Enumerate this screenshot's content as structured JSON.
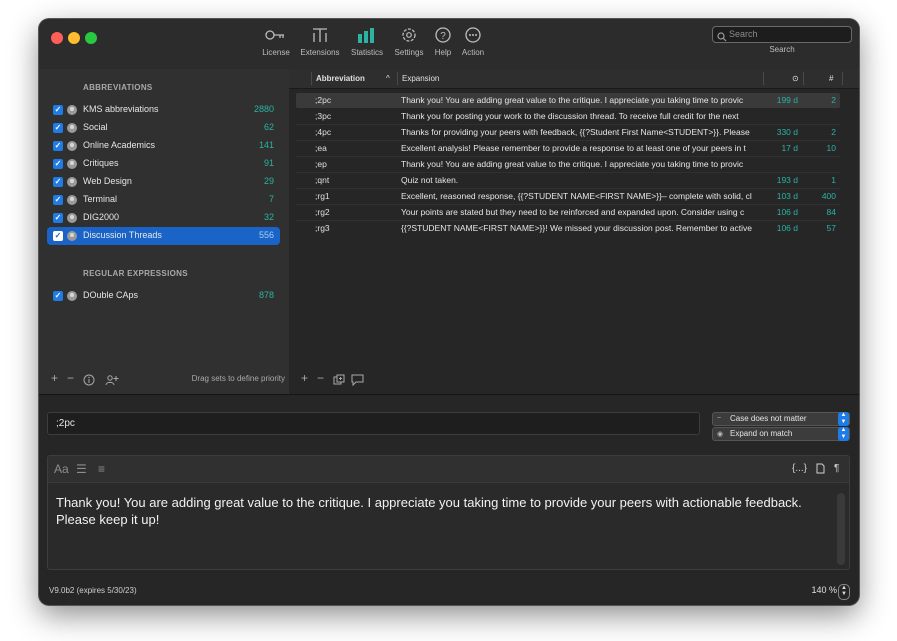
{
  "toolbar": {
    "items": [
      {
        "label": "License",
        "icon": "key-icon"
      },
      {
        "label": "Extensions",
        "icon": "extensions-icon"
      },
      {
        "label": "Statistics",
        "icon": "bar-chart-icon"
      },
      {
        "label": "Settings",
        "icon": "gear-icon"
      },
      {
        "label": "Help",
        "icon": "question-icon"
      },
      {
        "label": "Action",
        "icon": "ellipsis-icon"
      }
    ],
    "search_placeholder": "Search",
    "search_label": "Search"
  },
  "sidebar": {
    "abbreviations_header": "ABBREVIATIONS",
    "sets": [
      {
        "name": "KMS abbreviations",
        "count": "2880"
      },
      {
        "name": "Social",
        "count": "62"
      },
      {
        "name": "Online Academics",
        "count": "141"
      },
      {
        "name": "Critiques",
        "count": "91"
      },
      {
        "name": "Web Design",
        "count": "29"
      },
      {
        "name": "Terminal",
        "count": "7"
      },
      {
        "name": "DIG2000",
        "count": "32"
      },
      {
        "name": "Discussion Threads",
        "count": "556"
      }
    ],
    "regex_header": "REGULAR EXPRESSIONS",
    "regex_sets": [
      {
        "name": "DOuble CAps",
        "count": "878"
      }
    ],
    "footer_hint": "Drag sets to define priority"
  },
  "table": {
    "columns": {
      "abbreviation": "Abbreviation",
      "expansion": "Expansion",
      "age": "⊙",
      "count": "#"
    },
    "sort_indicator": "^",
    "rows": [
      {
        "abbr": ";2pc",
        "expansion": "Thank you! You are adding great value to the critique. I appreciate you taking time to provic",
        "age": "199 d",
        "num": "2"
      },
      {
        "abbr": ";3pc",
        "expansion": "Thank you for posting your work to the discussion thread. To receive full credit for the next",
        "age": "",
        "num": ""
      },
      {
        "abbr": ";4pc",
        "expansion": "Thanks for providing your peers with feedback, {{?Student First Name<STUDENT>}}. Please",
        "age": "330 d",
        "num": "2"
      },
      {
        "abbr": ";ea",
        "expansion": "Excellent analysis! Please remember to provide a response to at least one of your peers in t",
        "age": "17 d",
        "num": "10"
      },
      {
        "abbr": ";ep",
        "expansion": "Thank you! You are adding great value to the critique. I appreciate you taking time to provic",
        "age": "",
        "num": ""
      },
      {
        "abbr": ";qnt",
        "expansion": "Quiz not taken.",
        "age": "193 d",
        "num": "1"
      },
      {
        "abbr": ";rg1",
        "expansion": "Excellent, reasoned response, {{?STUDENT NAME<FIRST NAME>}}– complete with solid, cl",
        "age": "103 d",
        "num": "400"
      },
      {
        "abbr": ";rg2",
        "expansion": "Your points are stated but they need to be reinforced and expanded upon. Consider using c",
        "age": "106 d",
        "num": "84"
      },
      {
        "abbr": ";rg3",
        "expansion": "{{?STUDENT NAME<FIRST NAME>}}! We missed your discussion post. Remember to active",
        "age": "106 d",
        "num": "57"
      }
    ]
  },
  "detail": {
    "abbreviation_value": ";2pc",
    "case_option": "Case does not matter",
    "expand_option": "Expand on match",
    "editor_text": "Thank you! You are adding great value to the critique. I appreciate you taking time to provide your peers with actionable feedback. Please keep it up!",
    "editor_font_btn": "Aa",
    "editor_placeholder_btn": "{...}",
    "editor_para_btn": "¶"
  },
  "status": {
    "version": "V9.0b2 (expires 5/30/23)",
    "zoom": "140 %"
  },
  "colors": {
    "accent": "#1f7ce6",
    "selection": "#1a64c8",
    "count_teal": "#2bb3a3",
    "window_bg": "#262626"
  }
}
